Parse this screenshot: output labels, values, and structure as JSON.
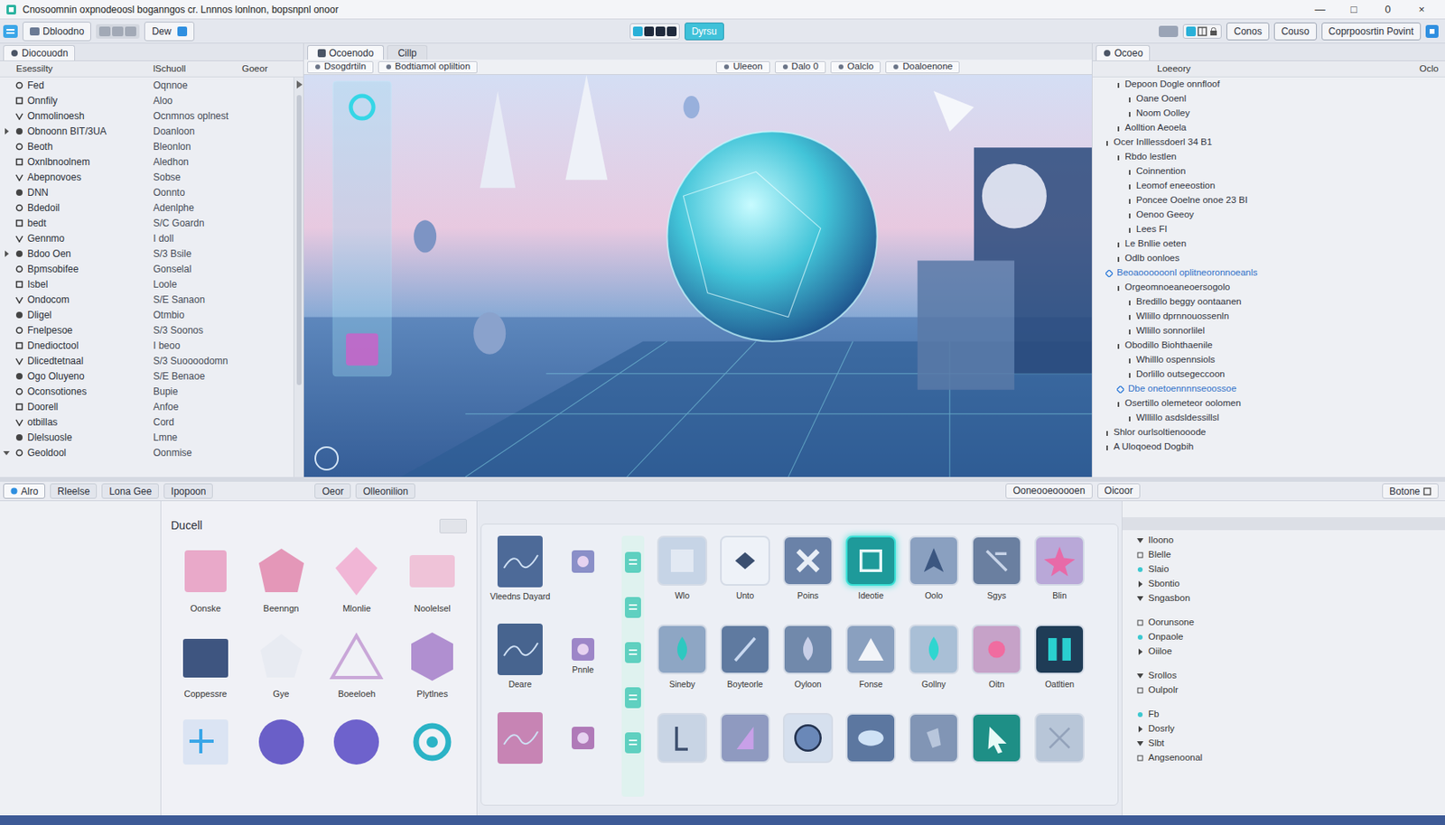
{
  "window": {
    "title": "Cnosoomnin oxpnodeoosl boganngos cr. Lnnnos lonlnon, bopsnpnl onoor",
    "controls": [
      "—",
      "□",
      "0",
      "×"
    ]
  },
  "toolbar": {
    "left": [
      "Dbloodno",
      "Dew"
    ],
    "mode": "Dyrsu",
    "right": [
      "Conos",
      "Couso",
      "Coprpoosrtin Povint"
    ]
  },
  "hierarchy": {
    "tab": "Diocouodn",
    "headers": [
      "Esessilty",
      "lSchuoll",
      "Goeor"
    ],
    "rows": [
      {
        "name": "Fed",
        "value": "Oqnnoe"
      },
      {
        "name": "Onnfily",
        "value": "Aloo"
      },
      {
        "name": "Onmolinoesh",
        "value": "Ocnmnos oplnest"
      },
      {
        "name": "Obnoonn BIT/3UA",
        "value": "Doanloon",
        "expanded": false
      },
      {
        "name": "Beoth",
        "value": "Bleonlon"
      },
      {
        "name": "Oxnlbnoolnem",
        "value": "Aledhon"
      },
      {
        "name": "Abepnovoes",
        "value": "Sobse"
      },
      {
        "name": "DNN",
        "value": "Oonnto"
      },
      {
        "name": "Bdedoil",
        "value": "Adenlphe"
      },
      {
        "name": "bedt",
        "value": "S/C Goardn"
      },
      {
        "name": "Gennmo",
        "value": "I doll"
      },
      {
        "name": "Bdoo Oen",
        "value": "S/3 Bsile",
        "expanded": false
      },
      {
        "name": "Bpmsobifee",
        "value": "Gonselal"
      },
      {
        "name": "Isbel",
        "value": "Loole"
      },
      {
        "name": "Ondocom",
        "value": "S/E Sanaon"
      },
      {
        "name": "Dligel",
        "value": "Otmbio"
      },
      {
        "name": "Fnelpesoe",
        "value": "S/3 Soonos"
      },
      {
        "name": "Dnedioctool",
        "value": "I beoo"
      },
      {
        "name": "Dlicedtetnaal",
        "value": "S/3 Suoooodomn"
      },
      {
        "name": "Ogo Oluyeno",
        "value": "S/E Benaoe"
      },
      {
        "name": "Oconsotiones",
        "value": "Bupie"
      },
      {
        "name": "Doorell",
        "value": "Anfoe"
      },
      {
        "name": "otbillas",
        "value": "Cord"
      },
      {
        "name": "Dlelsuosle",
        "value": "Lmne"
      },
      {
        "name": "Geoldool",
        "value": "Oonmise",
        "expanded": true
      }
    ]
  },
  "viewport": {
    "tabs": [
      {
        "label": "Ocoenodo",
        "selected": true
      },
      {
        "label": "Cillp",
        "selected": false
      }
    ],
    "toolbar": [
      "Dsogdrtiln",
      "Bodtiamol opliltion",
      "Uleeon",
      "Dalo 0",
      "Oalclo",
      "Doaloenone"
    ]
  },
  "inspector": {
    "tab": "Ocoeo",
    "headers": [
      "Loeeory",
      "Oclo"
    ],
    "items": [
      {
        "text": "Depoon Dogle onnfloof",
        "depth": 1,
        "highlighted": false
      },
      {
        "text": "Oane Ooenl",
        "depth": 2,
        "highlighted": false
      },
      {
        "text": "Noom Oolley",
        "depth": 2,
        "highlighted": false
      },
      {
        "text": "Aolltion Aeoela",
        "depth": 1,
        "highlighted": false
      },
      {
        "text": "Ocer Inlllessdoerl 34 B1",
        "depth": 0,
        "highlighted": false
      },
      {
        "text": "Rbdo lestlen",
        "depth": 1,
        "highlighted": false
      },
      {
        "text": "Coinnention",
        "depth": 2,
        "highlighted": false
      },
      {
        "text": "Leomof eneeostion",
        "depth": 2,
        "highlighted": false
      },
      {
        "text": "Poncee Ooelne onoe 23 BI",
        "depth": 2,
        "highlighted": false
      },
      {
        "text": "Oenoo Geeoy",
        "depth": 2,
        "highlighted": false
      },
      {
        "text": "Lees FI",
        "depth": 2,
        "highlighted": false
      },
      {
        "text": "Le Bnllie oeten",
        "depth": 1,
        "highlighted": false
      },
      {
        "text": "Odlb oonloes",
        "depth": 1,
        "highlighted": false
      },
      {
        "text": "Beoaoooooonl oplitneoronnoeanls",
        "depth": 0,
        "highlighted": true
      },
      {
        "text": "Orgeomnoeaneoersogolo",
        "depth": 1,
        "highlighted": false
      },
      {
        "text": "Bredillo beggy oontaanen",
        "depth": 2,
        "highlighted": false
      },
      {
        "text": "Wllillo dprnnouossenln",
        "depth": 2,
        "highlighted": false
      },
      {
        "text": "Wllillo sonnorlilel",
        "depth": 2,
        "highlighted": false
      },
      {
        "text": "Obodillo Biohthaenile",
        "depth": 1,
        "highlighted": false
      },
      {
        "text": "Whilllo ospennsiols",
        "depth": 2,
        "highlighted": false
      },
      {
        "text": "Dorlillo outsegeccoon",
        "depth": 2,
        "highlighted": false
      },
      {
        "text": "Dbe onetoennnnseoossoe",
        "depth": 1,
        "highlighted": true
      },
      {
        "text": "Osertillo olemeteor oolomen",
        "depth": 1,
        "highlighted": false
      },
      {
        "text": "Wlllillo asdsldessillsl",
        "depth": 2,
        "highlighted": false
      },
      {
        "text": "Shlor ourlsoltienooode",
        "depth": 0,
        "highlighted": false
      },
      {
        "text": "A Uloqoeod Dogbih",
        "depth": 0,
        "highlighted": false
      }
    ]
  },
  "bottom_tabs": {
    "left": [
      {
        "label": "Alro",
        "selected": true
      },
      {
        "label": "Rleelse",
        "selected": false
      },
      {
        "label": "Lona Gee",
        "selected": false
      },
      {
        "label": "Ipopoon",
        "selected": false
      },
      {
        "label": "Oeor",
        "selected": false
      },
      {
        "label": "Olleonilion",
        "selected": false
      }
    ],
    "right": [
      "Ooneooeooooen",
      "Oicoor"
    ],
    "corner": "Botone"
  },
  "assets": {
    "title": "Ducell",
    "items": [
      {
        "label": "Oonske"
      },
      {
        "label": "Beenngn"
      },
      {
        "label": "Mlonlie"
      },
      {
        "label": "Noolelsel"
      },
      {
        "label": "Coppessre"
      },
      {
        "label": "Gye"
      },
      {
        "label": "Boeeloeh"
      },
      {
        "label": "Plytlnes"
      },
      {},
      {},
      {},
      {}
    ]
  },
  "tools": {
    "side": [
      {
        "label": "Vleedns Dayard"
      },
      {},
      {
        "label": "Deare"
      },
      {
        "label": "Pnnle"
      },
      {},
      {}
    ],
    "items": [
      {
        "label": "Wlo",
        "selected": false
      },
      {
        "label": "Unto",
        "selected": false
      },
      {
        "label": "Poins",
        "selected": false
      },
      {
        "label": "Ideotie",
        "selected": true
      },
      {
        "label": "Oolo",
        "selected": false
      },
      {
        "label": "Sgys",
        "selected": false
      },
      {
        "label": "Blin",
        "selected": false
      },
      {
        "label": "Sineby",
        "selected": false
      },
      {
        "label": "Boyteorle",
        "selected": false
      },
      {
        "label": "Oyloon",
        "selected": false
      },
      {
        "label": "Fonse",
        "selected": false
      },
      {
        "label": "Gollny",
        "selected": false
      },
      {
        "label": "Oitn",
        "selected": false
      },
      {
        "label": "Oatltien",
        "selected": false
      },
      {
        "selected": false
      },
      {
        "selected": false
      },
      {
        "selected": false
      },
      {
        "selected": false
      },
      {
        "selected": false
      },
      {
        "selected": false
      },
      {
        "selected": false
      }
    ]
  },
  "properties": {
    "items": [
      "Iloono",
      "Blelle",
      "Slaio",
      "Sbontio",
      "Sngasbon",
      "Oorunsone",
      "Onpaole",
      "Oiiloe",
      "Srollos",
      "Oulpolr",
      "Fb",
      "Dosrly",
      "Slbt",
      "Angsenoonal"
    ]
  }
}
